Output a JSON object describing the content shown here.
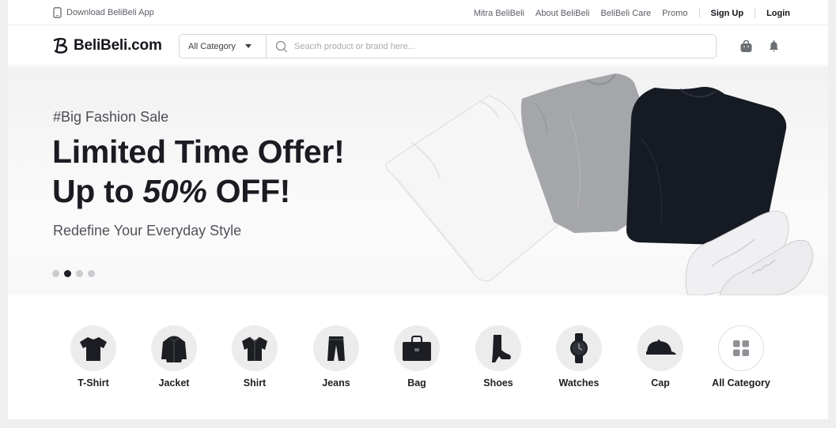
{
  "topbar": {
    "app_label": "Download BeliBeli App",
    "links": [
      "Mitra BeliBeli",
      "About BeliBeli",
      "BeliBeli Care",
      "Promo"
    ],
    "signup": "Sign Up",
    "login": "Login"
  },
  "header": {
    "logo_text": "BeliBeli.com",
    "category_select": "All Category",
    "search_placeholder": "Seacrh product or brand here..."
  },
  "hero": {
    "tag": "#Big Fashion Sale",
    "headline_line1": "Limited Time Offer!",
    "headline_line2_prefix": "Up to ",
    "headline_line2_em": "50%",
    "headline_line2_suffix": " OFF!",
    "subtitle": "Redefine Your Everyday Style",
    "slide_count": 4,
    "active_slide": 2
  },
  "categories": [
    {
      "label": "T-Shirt",
      "icon": "tshirt-icon"
    },
    {
      "label": "Jacket",
      "icon": "jacket-icon"
    },
    {
      "label": "Shirt",
      "icon": "shirt-icon"
    },
    {
      "label": "Jeans",
      "icon": "jeans-icon"
    },
    {
      "label": "Bag",
      "icon": "bag-icon"
    },
    {
      "label": "Shoes",
      "icon": "shoes-icon"
    },
    {
      "label": "Watches",
      "icon": "watch-icon"
    },
    {
      "label": "Cap",
      "icon": "cap-icon"
    },
    {
      "label": "All Category",
      "icon": "grid-icon"
    }
  ],
  "colors": {
    "text_dark": "#1d1f24",
    "text_muted": "#5a5d64",
    "border": "#d4d6da",
    "category_bg": "#ececec"
  }
}
